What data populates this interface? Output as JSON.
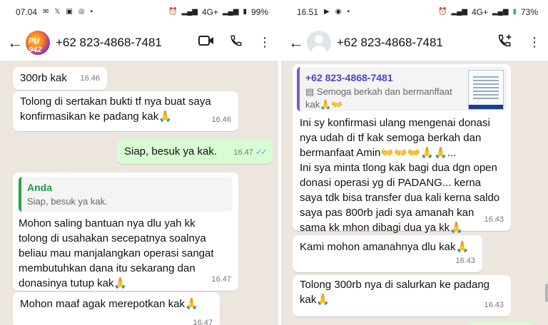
{
  "left": {
    "status": {
      "time": "07.04",
      "battery": "99%",
      "network": "4G+"
    },
    "contact": "+62 823-4868-7481",
    "avatar_text": "PU 942",
    "messages": {
      "m1": {
        "text": "300rb kak",
        "time": "16.46"
      },
      "m2": {
        "text": "Tolong di sertakan bukti tf nya buat saya\nkonfirmasikan ke padang kak🙏",
        "time": "16.46"
      },
      "m3": {
        "text": "Siap, besuk ya kak.",
        "time": "16.47",
        "ticks": "✓✓"
      },
      "m4": {
        "quote_author": "Anda",
        "quote_text": "Siap, besuk ya kak.",
        "text": "Mohon saling bantuan nya dlu yah kk\ntolong di usahakan secepatnya soalnya\nbeliau mau manjalangkan operasi sangat\nmembutuhkan dana itu sekarang dan\ndonasinya tutup kak🙏",
        "time": "16.47"
      },
      "m5": {
        "text": "Mohon maaf agak merepotkan kak🙏",
        "time": "16.47"
      }
    }
  },
  "right": {
    "status": {
      "time": "16.51",
      "battery": "73%",
      "network": "4G+"
    },
    "contact": "+62 823-4868-7481",
    "messages": {
      "r1": {
        "quote_author": "+62 823-4868-7481",
        "quote_text": "Semoga berkah dan bermanffaat kak🙏👐",
        "text": "Ini sy konfirmasi ulang mengenai donasi\nnya udah di tf kak semoga berkah dan\nbermanfaat Amin👐👐👐🙏🙏...\nIni sya minta tlong kak bagi dua dgn open\ndonasi operasi yg di PADANG... kerna\nsaya tdk bisa transfer dua kali kerna saldo\nsaya pas 800rb jadi sya amanah kan\nsama kk mhon dibagi dua ya kk🙏",
        "time": "16.43"
      },
      "r2": {
        "text": "Kami mohon amanahnya dlu kak🙏",
        "time": "16.43"
      },
      "r3": {
        "text": "Tolong 300rb nya di salurkan ke padang\nkak🙏",
        "time": "16.43"
      }
    }
  },
  "icons": {
    "back": "arrow-back-icon",
    "video": "video-call-icon",
    "call": "phone-icon",
    "menu": "more-vert-icon",
    "add_call": "add-call-icon"
  },
  "colors": {
    "chat_bg": "#ece6df",
    "outgoing": "#d8fdd2",
    "incoming": "#ffffff",
    "read_ticks": "#53a6fd",
    "quote_green": "#2aa24d"
  }
}
